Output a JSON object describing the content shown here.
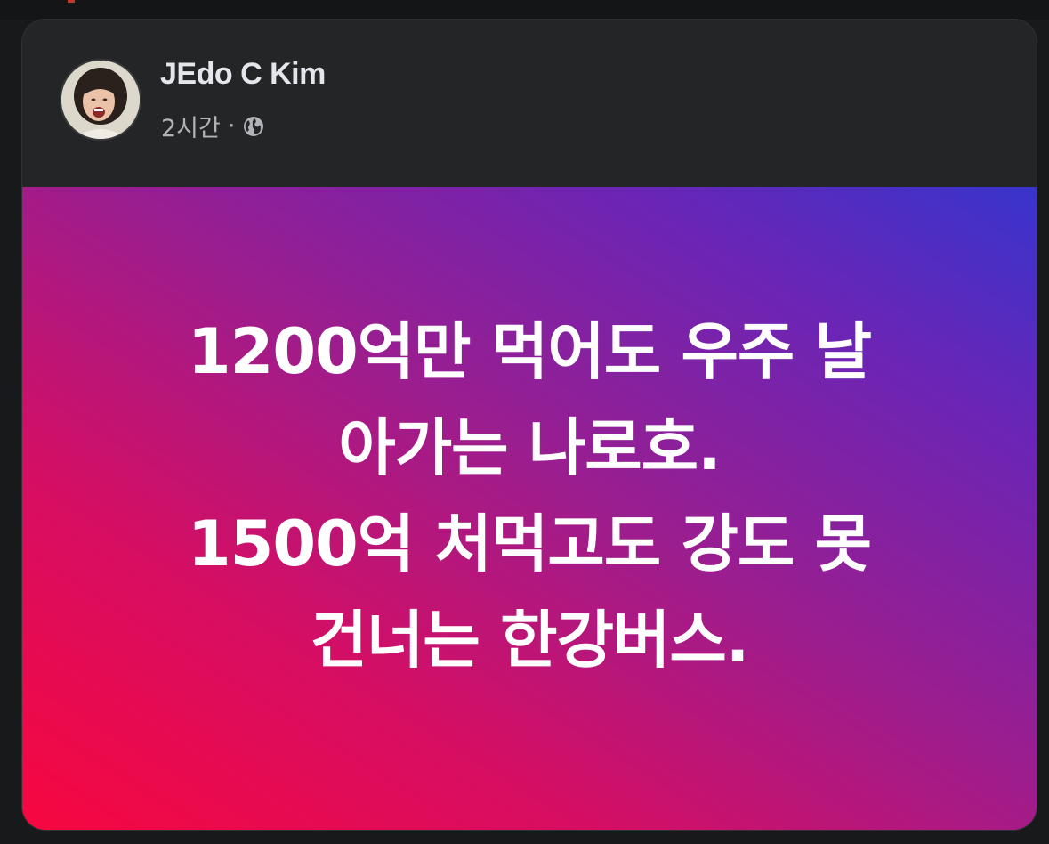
{
  "post": {
    "author": "JEdo C Kim",
    "time": "2시간",
    "separator": "·",
    "privacy_icon": "globe-icon",
    "text_lines": [
      "1200억만 먹어도 우주 날",
      "아가는 나로호.",
      "1500억 처먹고도 강도 못",
      "건너는 한강버스."
    ],
    "background_colors": [
      "#f7073f",
      "#d60e63",
      "#991e90",
      "#6a25b6",
      "#3834cc"
    ]
  }
}
